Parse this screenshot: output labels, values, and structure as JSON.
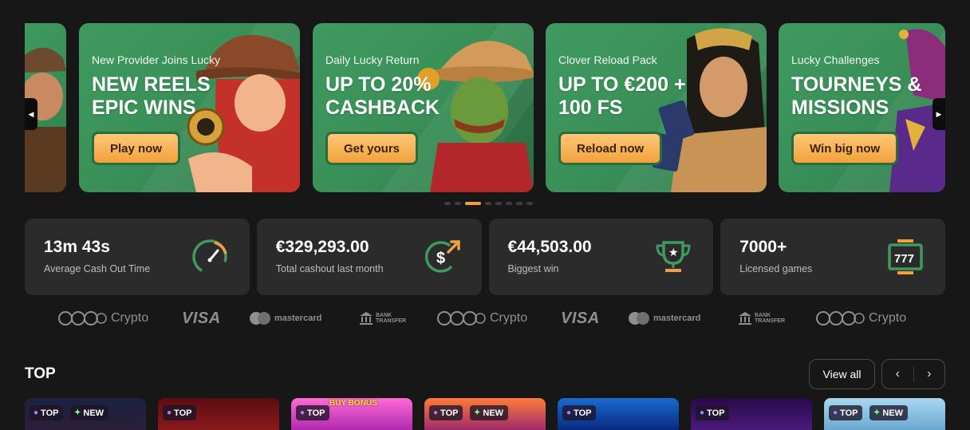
{
  "promos": [
    {
      "eyebrow": "New Provider Joins Lucky",
      "headline_1": "NEW REELS",
      "headline_2": "EPIC WINS",
      "cta": "Play now"
    },
    {
      "eyebrow": "Daily Lucky Return",
      "headline_1": "UP TO 20%",
      "headline_2": "CASHBACK",
      "cta": "Get yours"
    },
    {
      "eyebrow": "Clover Reload Pack",
      "headline_1": "UP TO €200 +",
      "headline_2": "100 FS",
      "cta": "Reload now"
    },
    {
      "eyebrow": "Lucky Challenges",
      "headline_1": "TOURNEYS &",
      "headline_2": "MISSIONS",
      "cta": "Win big now"
    }
  ],
  "carousel": {
    "prev_icon": "chevron-left-icon",
    "next_icon": "chevron-right-icon",
    "dot_count": 8,
    "active_dot": 2
  },
  "stats": [
    {
      "value": "13m 43s",
      "label": "Average Cash Out Time",
      "icon": "speedometer-icon"
    },
    {
      "value": "€329,293.00",
      "label": "Total cashout last month",
      "icon": "dollar-up-icon"
    },
    {
      "value": "€44,503.00",
      "label": "Biggest win",
      "icon": "trophy-icon"
    },
    {
      "value": "7000+",
      "label": "Licensed games",
      "icon": "slot-777-icon"
    }
  ],
  "payments": {
    "crypto": "Crypto",
    "visa": "VISA",
    "mastercard": "mastercard",
    "bank_1": "BANK",
    "bank_2": "TRANSFER"
  },
  "section": {
    "title": "TOP",
    "view_all": "View all",
    "prev": "‹",
    "next": "›"
  },
  "games": [
    {
      "badges": [
        "TOP",
        "NEW"
      ]
    },
    {
      "badges": [
        "TOP"
      ]
    },
    {
      "badges": [
        "TOP"
      ],
      "label": "BUY BONUS"
    },
    {
      "badges": [
        "TOP",
        "NEW"
      ]
    },
    {
      "badges": [
        "TOP"
      ]
    },
    {
      "badges": [
        "TOP"
      ]
    },
    {
      "badges": [
        "TOP",
        "NEW"
      ]
    }
  ],
  "colors": {
    "background": "#171717",
    "card": "#2b2b2b",
    "promo_green": "#3a9158",
    "accent_orange": "#f0a040",
    "stat_icon_green": "#3f9a5f"
  }
}
